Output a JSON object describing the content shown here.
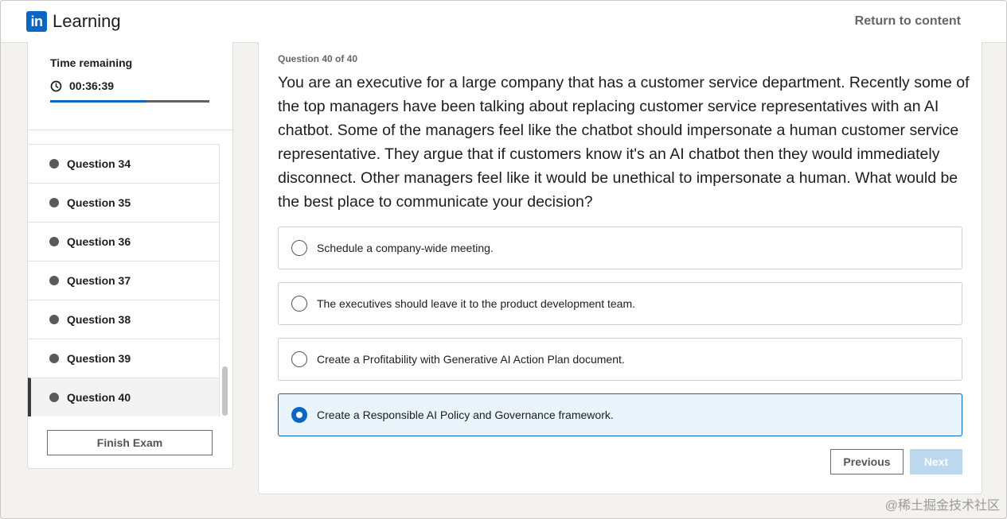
{
  "header": {
    "logo_badge": "in",
    "logo_text": "Learning",
    "return_link": "Return to content"
  },
  "timer": {
    "label": "Time remaining",
    "value": "00:36:39",
    "progress_fraction": 0.6
  },
  "questions": [
    {
      "label": "Question 34"
    },
    {
      "label": "Question 35"
    },
    {
      "label": "Question 36"
    },
    {
      "label": "Question 37"
    },
    {
      "label": "Question 38"
    },
    {
      "label": "Question 39"
    },
    {
      "label": "Question 40",
      "active": true
    }
  ],
  "finish_button": "Finish Exam",
  "question": {
    "count": "Question 40 of 40",
    "text": "You are an executive for a large company that has a customer service department. Recently some of the top managers have been talking about replacing customer service representatives with an AI chatbot. Some of the managers feel like the chatbot should impersonate a human customer service representative. They argue that if customers know it's an AI chatbot then they would immediately disconnect. Other managers feel like it would be unethical to impersonate a human. What would be the best place to communicate your decision?",
    "options": [
      {
        "label": "Schedule a company-wide meeting.",
        "selected": false
      },
      {
        "label": "The executives should leave it to the product development team.",
        "selected": false
      },
      {
        "label": "Create a Profitability with Generative AI Action Plan document.",
        "selected": false
      },
      {
        "label": "Create a Responsible AI Policy and Governance framework.",
        "selected": true
      }
    ]
  },
  "nav": {
    "previous": "Previous",
    "next": "Next"
  },
  "watermark": "@稀土掘金技术社区",
  "colors": {
    "brand": "#0a66c2",
    "selected_bg": "#e8f4fa",
    "next_disabled": "#bcd8ee"
  }
}
